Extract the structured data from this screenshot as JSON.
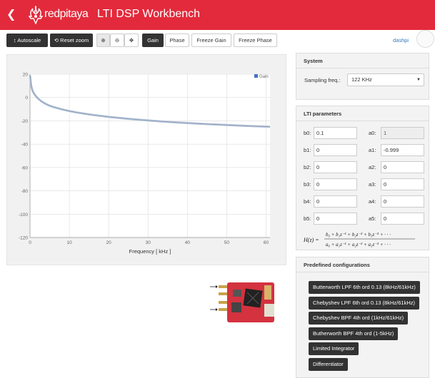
{
  "header": {
    "back_icon": "chevron-left-icon",
    "logo_icon": "redpitaya-flame-logo-icon",
    "logo_text": "redpitaya",
    "title": "LTI DSP Workbench",
    "color": "#e32a3c"
  },
  "toolbar": {
    "autoscale": "Autoscale",
    "reset_zoom": "Reset zoom",
    "zoom_in_icon": "zoom-in-icon",
    "zoom_out_icon": "zoom-out-icon",
    "pan_icon": "pan-arrows-icon",
    "gain": "Gain",
    "phase": "Phase",
    "freeze_gain": "Freeze Gain",
    "freeze_phase": "Freeze Phase"
  },
  "user": {
    "name": "dashpi"
  },
  "chart_data": {
    "type": "line",
    "xlabel": "Frequency [ kHz ]",
    "ylabel": "",
    "xlim": [
      0,
      61
    ],
    "ylim": [
      -120,
      20
    ],
    "xticks": [
      0,
      10,
      20,
      30,
      40,
      50,
      60
    ],
    "yticks": [
      20,
      0,
      -20,
      -40,
      -60,
      -80,
      -100,
      -120
    ],
    "grid": true,
    "legend_position": "top-right",
    "series_color": "#4472c4",
    "series": [
      {
        "name": "Gain",
        "x": [
          0.02,
          0.3,
          0.6,
          1,
          1.5,
          2,
          3,
          4,
          5,
          6,
          8,
          10,
          12,
          15,
          20,
          25,
          30,
          35,
          40,
          45,
          50,
          55,
          61
        ],
        "y": [
          19,
          10,
          6.2,
          3.5,
          1.2,
          -0.8,
          -3.5,
          -5.5,
          -7,
          -8.2,
          -10.1,
          -11.6,
          -12.9,
          -14.5,
          -16.6,
          -18.3,
          -19.7,
          -20.9,
          -21.9,
          -22.8,
          -23.6,
          -24.3,
          -25.1
        ]
      }
    ]
  },
  "system": {
    "title": "System",
    "sampling_label": "Sampling freq.:",
    "sampling_value": "122 KHz"
  },
  "lti": {
    "title": "LTI parameters",
    "rows": [
      {
        "b_label": "b0:",
        "b_value": "0.1",
        "a_label": "a0:",
        "a_value": "1"
      },
      {
        "b_label": "b1:",
        "b_value": "0",
        "a_label": "a1:",
        "a_value": "-0.999"
      },
      {
        "b_label": "b2:",
        "b_value": "0",
        "a_label": "a2:",
        "a_value": "0"
      },
      {
        "b_label": "b3:",
        "b_value": "0",
        "a_label": "a3:",
        "a_value": "0"
      },
      {
        "b_label": "b4:",
        "b_value": "0",
        "a_label": "a4:",
        "a_value": "0"
      },
      {
        "b_label": "b5:",
        "b_value": "0",
        "a_label": "a5:",
        "a_value": "0"
      }
    ],
    "formula_lhs": "H(z) =",
    "formula_num": "b₀ + b₁z⁻¹ + b₂z⁻² + b₃z⁻³ + · · ·",
    "formula_den": "a₀ + a₁z⁻¹ + a₂z⁻² + a₃z⁻³ + · · ·"
  },
  "predefined": {
    "title": "Predefined configurations",
    "items": [
      "Butterworth LPF 6th ord 0.13 (8kHz/61kHz)",
      "Chebyshev LPF 6th ord 0.13 (8kHz/61kHz)",
      "Chebyshev BPF 4th ord (1kHz/61kHz)",
      "Butherworth BPF 4th ord (1-5kHz)",
      "Limited Integrator",
      "Differentiator"
    ]
  }
}
